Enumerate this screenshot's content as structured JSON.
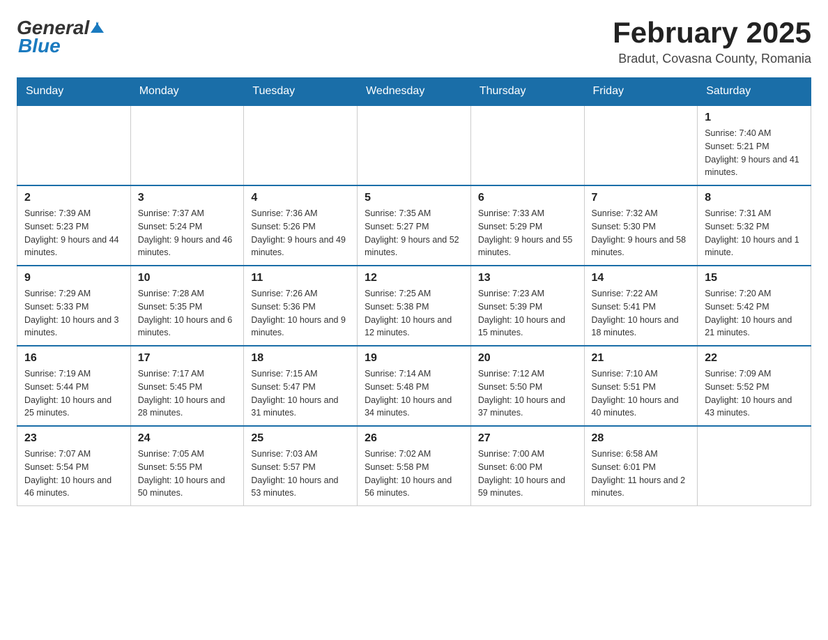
{
  "header": {
    "title": "February 2025",
    "subtitle": "Bradut, Covasna County, Romania",
    "logo_general": "General",
    "logo_blue": "Blue"
  },
  "weekdays": [
    "Sunday",
    "Monday",
    "Tuesday",
    "Wednesday",
    "Thursday",
    "Friday",
    "Saturday"
  ],
  "weeks": [
    [
      {
        "day": "",
        "info": ""
      },
      {
        "day": "",
        "info": ""
      },
      {
        "day": "",
        "info": ""
      },
      {
        "day": "",
        "info": ""
      },
      {
        "day": "",
        "info": ""
      },
      {
        "day": "",
        "info": ""
      },
      {
        "day": "1",
        "info": "Sunrise: 7:40 AM\nSunset: 5:21 PM\nDaylight: 9 hours and 41 minutes."
      }
    ],
    [
      {
        "day": "2",
        "info": "Sunrise: 7:39 AM\nSunset: 5:23 PM\nDaylight: 9 hours and 44 minutes."
      },
      {
        "day": "3",
        "info": "Sunrise: 7:37 AM\nSunset: 5:24 PM\nDaylight: 9 hours and 46 minutes."
      },
      {
        "day": "4",
        "info": "Sunrise: 7:36 AM\nSunset: 5:26 PM\nDaylight: 9 hours and 49 minutes."
      },
      {
        "day": "5",
        "info": "Sunrise: 7:35 AM\nSunset: 5:27 PM\nDaylight: 9 hours and 52 minutes."
      },
      {
        "day": "6",
        "info": "Sunrise: 7:33 AM\nSunset: 5:29 PM\nDaylight: 9 hours and 55 minutes."
      },
      {
        "day": "7",
        "info": "Sunrise: 7:32 AM\nSunset: 5:30 PM\nDaylight: 9 hours and 58 minutes."
      },
      {
        "day": "8",
        "info": "Sunrise: 7:31 AM\nSunset: 5:32 PM\nDaylight: 10 hours and 1 minute."
      }
    ],
    [
      {
        "day": "9",
        "info": "Sunrise: 7:29 AM\nSunset: 5:33 PM\nDaylight: 10 hours and 3 minutes."
      },
      {
        "day": "10",
        "info": "Sunrise: 7:28 AM\nSunset: 5:35 PM\nDaylight: 10 hours and 6 minutes."
      },
      {
        "day": "11",
        "info": "Sunrise: 7:26 AM\nSunset: 5:36 PM\nDaylight: 10 hours and 9 minutes."
      },
      {
        "day": "12",
        "info": "Sunrise: 7:25 AM\nSunset: 5:38 PM\nDaylight: 10 hours and 12 minutes."
      },
      {
        "day": "13",
        "info": "Sunrise: 7:23 AM\nSunset: 5:39 PM\nDaylight: 10 hours and 15 minutes."
      },
      {
        "day": "14",
        "info": "Sunrise: 7:22 AM\nSunset: 5:41 PM\nDaylight: 10 hours and 18 minutes."
      },
      {
        "day": "15",
        "info": "Sunrise: 7:20 AM\nSunset: 5:42 PM\nDaylight: 10 hours and 21 minutes."
      }
    ],
    [
      {
        "day": "16",
        "info": "Sunrise: 7:19 AM\nSunset: 5:44 PM\nDaylight: 10 hours and 25 minutes."
      },
      {
        "day": "17",
        "info": "Sunrise: 7:17 AM\nSunset: 5:45 PM\nDaylight: 10 hours and 28 minutes."
      },
      {
        "day": "18",
        "info": "Sunrise: 7:15 AM\nSunset: 5:47 PM\nDaylight: 10 hours and 31 minutes."
      },
      {
        "day": "19",
        "info": "Sunrise: 7:14 AM\nSunset: 5:48 PM\nDaylight: 10 hours and 34 minutes."
      },
      {
        "day": "20",
        "info": "Sunrise: 7:12 AM\nSunset: 5:50 PM\nDaylight: 10 hours and 37 minutes."
      },
      {
        "day": "21",
        "info": "Sunrise: 7:10 AM\nSunset: 5:51 PM\nDaylight: 10 hours and 40 minutes."
      },
      {
        "day": "22",
        "info": "Sunrise: 7:09 AM\nSunset: 5:52 PM\nDaylight: 10 hours and 43 minutes."
      }
    ],
    [
      {
        "day": "23",
        "info": "Sunrise: 7:07 AM\nSunset: 5:54 PM\nDaylight: 10 hours and 46 minutes."
      },
      {
        "day": "24",
        "info": "Sunrise: 7:05 AM\nSunset: 5:55 PM\nDaylight: 10 hours and 50 minutes."
      },
      {
        "day": "25",
        "info": "Sunrise: 7:03 AM\nSunset: 5:57 PM\nDaylight: 10 hours and 53 minutes."
      },
      {
        "day": "26",
        "info": "Sunrise: 7:02 AM\nSunset: 5:58 PM\nDaylight: 10 hours and 56 minutes."
      },
      {
        "day": "27",
        "info": "Sunrise: 7:00 AM\nSunset: 6:00 PM\nDaylight: 10 hours and 59 minutes."
      },
      {
        "day": "28",
        "info": "Sunrise: 6:58 AM\nSunset: 6:01 PM\nDaylight: 11 hours and 2 minutes."
      },
      {
        "day": "",
        "info": ""
      }
    ]
  ]
}
